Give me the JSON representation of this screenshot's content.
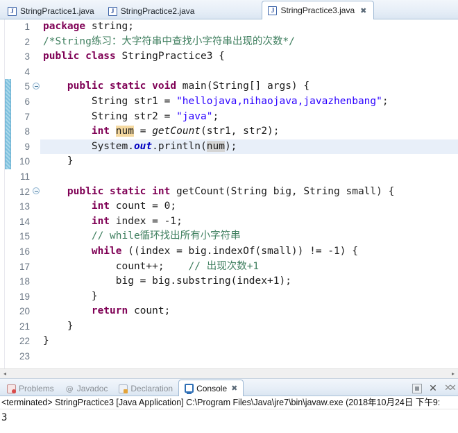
{
  "editor_tabs": [
    {
      "label": "StringPractice1.java",
      "icon": "java-file-icon",
      "active": false,
      "close": ""
    },
    {
      "label": "StringPractice2.java",
      "icon": "java-file-icon",
      "active": false,
      "close": ""
    },
    {
      "label": "StringPractice3.java",
      "icon": "java-file-icon",
      "active": true,
      "close": "✖"
    }
  ],
  "tab_icon_glyph": "J",
  "gutter": {
    "numbers": [
      "1",
      "2",
      "3",
      "4",
      "5",
      "6",
      "7",
      "8",
      "9",
      "10",
      "11",
      "12",
      "13",
      "14",
      "15",
      "16",
      "17",
      "18",
      "19",
      "20",
      "21",
      "22",
      "23"
    ],
    "fold_lines": [
      "5",
      "12"
    ]
  },
  "code": {
    "lines": [
      "package string;",
      "/*String练习：大字符串中查找小字符串出现的次数*/",
      "public class StringPractice3 {",
      "",
      "    public static void main(String[] args) {",
      "        String str1 = \"hellojava,nihaojava,javazhenbang\";",
      "        String str2 = \"java\";",
      "        int num = getCount(str1, str2);",
      "        System.out.println(num);",
      "    }",
      "",
      "    public static int getCount(String big, String small) {",
      "        int count = 0;",
      "        int index = -1;",
      "        // while循环找出所有小字符串",
      "        while ((index = big.indexOf(small)) != -1) {",
      "            count++;    // 出现次数+1",
      "            big = big.substring(index+1);",
      "        }",
      "        return count;",
      "    }",
      "}",
      ""
    ],
    "current_line": 9,
    "occurrence_write": "num",
    "occurrence_read": "num"
  },
  "scrollbar": {
    "left_arrow": "◂",
    "right_arrow": "▸"
  },
  "view_tabs": [
    {
      "label": "Problems",
      "icon": "problems-icon",
      "active": false,
      "close": ""
    },
    {
      "label": "Javadoc",
      "icon": "javadoc-icon",
      "active": false,
      "close": ""
    },
    {
      "label": "Declaration",
      "icon": "declaration-icon",
      "active": false,
      "close": ""
    },
    {
      "label": "Console",
      "icon": "console-icon",
      "active": true,
      "close": "✖"
    }
  ],
  "view_toolbar": [
    {
      "name": "terminate-button",
      "glyph": ""
    },
    {
      "name": "remove-console-button",
      "glyph": "✕"
    },
    {
      "name": "remove-all-button",
      "glyph": "✕✕"
    }
  ],
  "console": {
    "status_line": "<terminated> StringPractice3 [Java Application] C:\\Program Files\\Java\\jre7\\bin\\javaw.exe (2018年10月24日 下午9:",
    "output": "3"
  },
  "colors": {
    "keyword": "#7f0055",
    "string": "#2a00ff",
    "comment": "#3f7f5f",
    "field": "#0000c0",
    "current_line_bg": "#e8eff9",
    "occurrence_write_bg": "#f5d9a0",
    "occurrence_read_bg": "#d4d4d4",
    "change_bar": "#7fc0de",
    "tab_active_bg": "#ffffff"
  }
}
